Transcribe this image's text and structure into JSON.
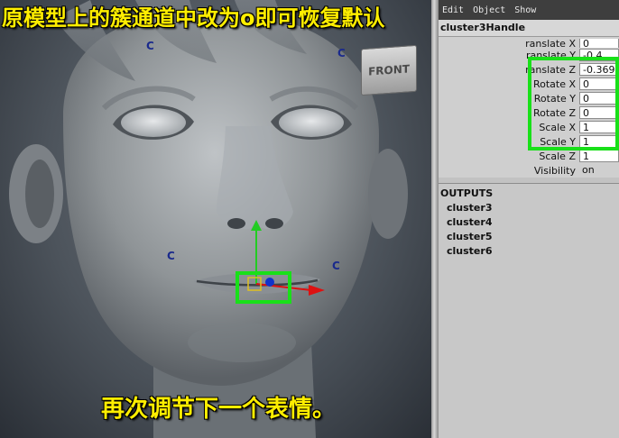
{
  "captions": {
    "top": "原模型上的簇通道中改为o即可恢复默认",
    "bottom": "再次调节下一个表情。"
  },
  "viewport": {
    "viewcube_label": "FRONT",
    "cluster_marker_label": "C"
  },
  "attribute_editor": {
    "menu": [
      "Edit",
      "Object",
      "Show"
    ],
    "node_name": "cluster3Handle",
    "attributes": [
      {
        "label": "ranslate X",
        "value": "0"
      },
      {
        "label": "ranslate Y",
        "value": "-0.4"
      },
      {
        "label": "ranslate Z",
        "value": "-0.369"
      },
      {
        "label": "Rotate X",
        "value": "0"
      },
      {
        "label": "Rotate Y",
        "value": "0"
      },
      {
        "label": "Rotate Z",
        "value": "0"
      },
      {
        "label": "Scale X",
        "value": "1"
      },
      {
        "label": "Scale Y",
        "value": "1"
      },
      {
        "label": "Scale Z",
        "value": "1"
      },
      {
        "label": "Visibility",
        "value": "on"
      }
    ],
    "outputs_title": "OUTPUTS",
    "outputs": [
      "cluster3",
      "cluster4",
      "cluster5",
      "cluster6"
    ]
  },
  "colors": {
    "caption": "#ffee00",
    "highlight": "#19e019",
    "cluster_marker": "#1a2a8c",
    "manipulator_y": "#22cc22",
    "manipulator_x": "#dd1111",
    "manipulator_z": "#1133cc"
  }
}
